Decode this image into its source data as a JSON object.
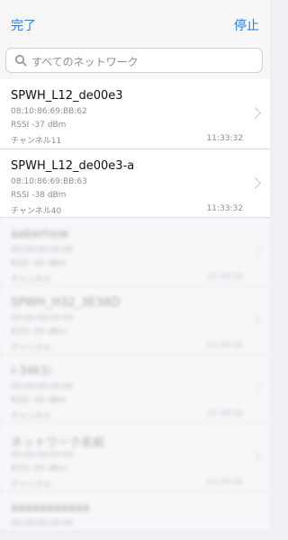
{
  "nav": {
    "left": "完了",
    "right": "停止"
  },
  "search": {
    "placeholder": "すべてのネットワーク"
  },
  "rows": [
    {
      "ssid": "SPWH_L12_de00e3",
      "mac": "08:10:86:69:BB:62",
      "rssi": "RSSI -37 dBm",
      "channel": "チャンネル11",
      "time": "11:33:32"
    },
    {
      "ssid": "SPWH_L12_de00e3-a",
      "mac": "08:10:86:69:BB:63",
      "rssi": "RSSI -38 dBm",
      "channel": "チャンネル40",
      "time": "11:33:32"
    }
  ],
  "blurred_rows": [
    {
      "ssid": "aaberhew",
      "mac": "00:00:00:00:00",
      "rssi": "RSSI -00 dBm",
      "channel": "チャンネル",
      "time": "11:33:32"
    },
    {
      "ssid": "SPWH_H32_3E3AD",
      "mac": "00:00:00:00:00",
      "rssi": "RSSI -00 dBm",
      "channel": "チャンネル",
      "time": "11:33:32"
    },
    {
      "ssid": "r-34k1i",
      "mac": "00:00:00:00:00",
      "rssi": "RSSI -00 dBm",
      "channel": "チャンネル",
      "time": "11:33:32"
    },
    {
      "ssid": "ネットワーク名前",
      "mac": "00:00:00:00:00",
      "rssi": "RSSI -00 dBm",
      "channel": "チャンネル",
      "time": "11:33:32"
    },
    {
      "ssid": "aaaaaaaaaaa",
      "mac": "00:00:00:00:00",
      "rssi": "",
      "channel": "",
      "time": ""
    }
  ]
}
